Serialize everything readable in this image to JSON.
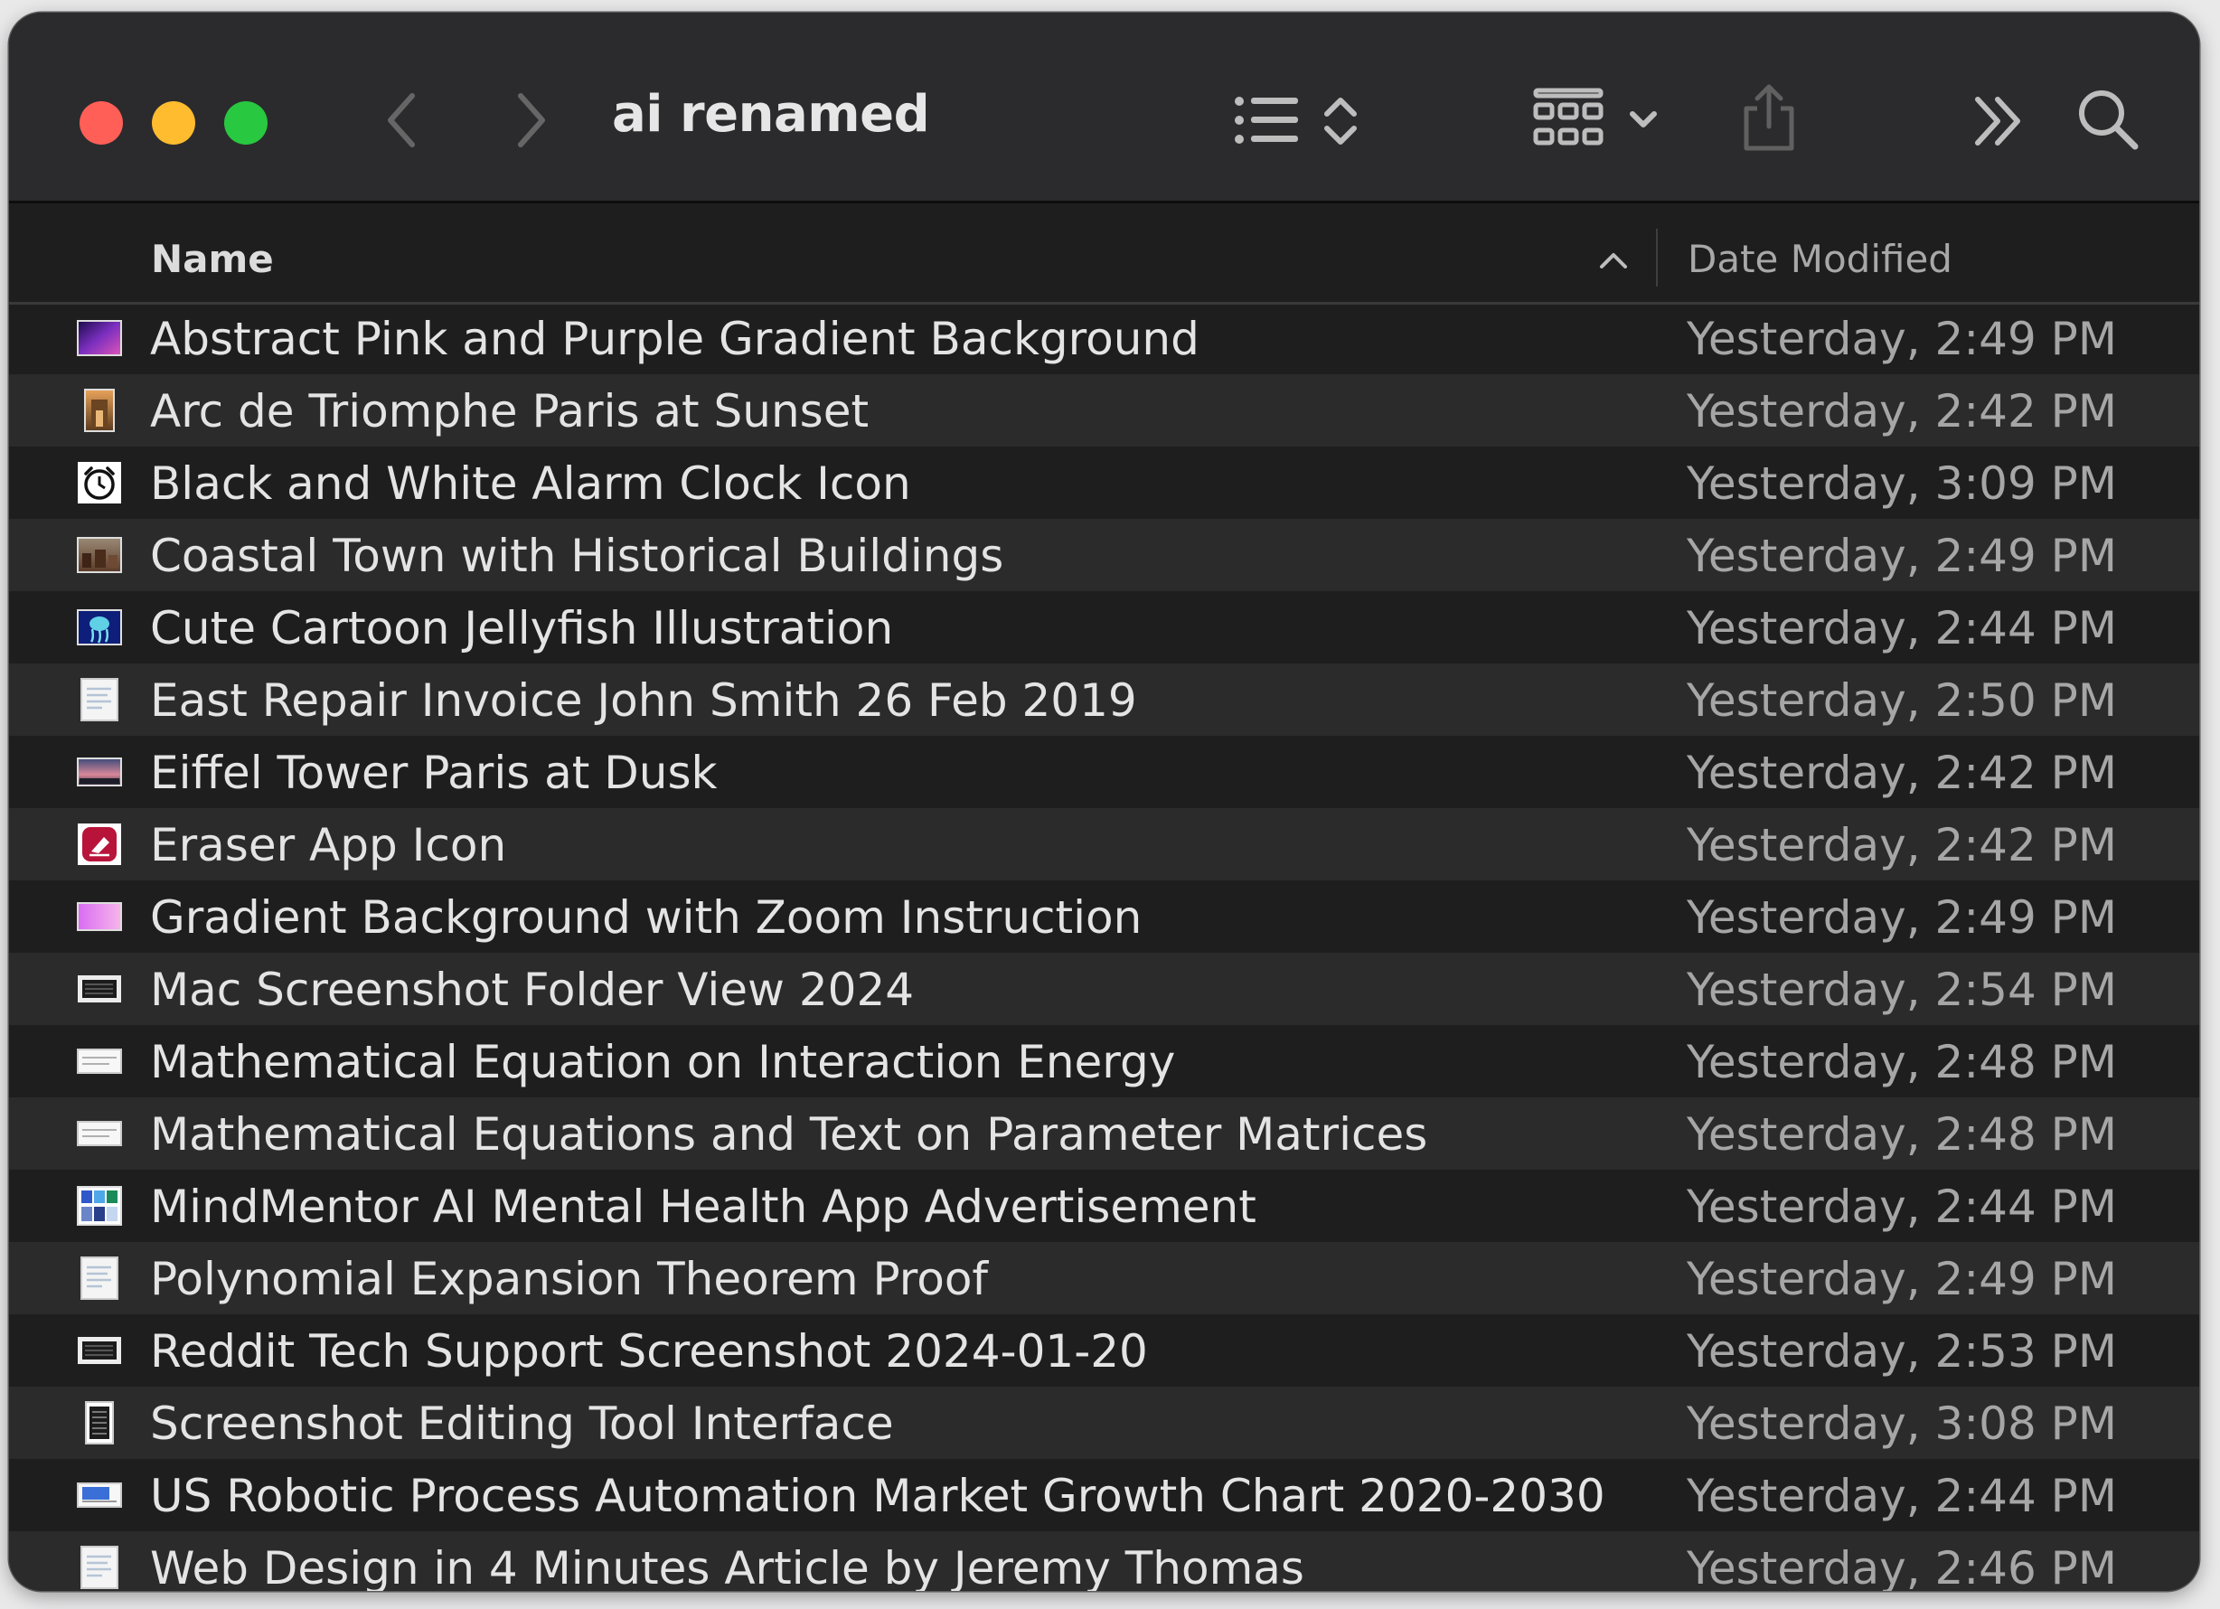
{
  "window": {
    "title": "ai renamed",
    "colors": {
      "close": "#ff5f57",
      "minimize": "#febc2e",
      "zoom": "#28c840"
    }
  },
  "toolbar": {
    "icons": [
      "back-icon",
      "forward-icon",
      "list-view-icon",
      "group-icon",
      "share-icon",
      "more-icon",
      "search-icon"
    ]
  },
  "header": {
    "name_label": "Name",
    "date_label": "Date Modified",
    "sort": "ascending"
  },
  "files": [
    {
      "name": "Abstract Pink and Purple Gradient Background",
      "date": "Yesterday, 2:49 PM",
      "thumb": "gradient-purple"
    },
    {
      "name": "Arc de Triomphe Paris at Sunset",
      "date": "Yesterday, 2:42 PM",
      "thumb": "photo-arc"
    },
    {
      "name": "Black and White Alarm Clock Icon",
      "date": "Yesterday, 3:09 PM",
      "thumb": "clock"
    },
    {
      "name": "Coastal Town with Historical Buildings",
      "date": "Yesterday, 2:49 PM",
      "thumb": "photo-town"
    },
    {
      "name": "Cute Cartoon Jellyfish Illustration",
      "date": "Yesterday, 2:44 PM",
      "thumb": "jellyfish"
    },
    {
      "name": "East Repair Invoice John Smith 26 Feb 2019",
      "date": "Yesterday, 2:50 PM",
      "thumb": "document"
    },
    {
      "name": "Eiffel Tower Paris at Dusk",
      "date": "Yesterday, 2:42 PM",
      "thumb": "photo-dusk"
    },
    {
      "name": "Eraser App Icon",
      "date": "Yesterday, 2:42 PM",
      "thumb": "eraser"
    },
    {
      "name": "Gradient Background with Zoom Instruction",
      "date": "Yesterday, 2:49 PM",
      "thumb": "gradient-pink"
    },
    {
      "name": "Mac Screenshot Folder View 2024",
      "date": "Yesterday, 2:54 PM",
      "thumb": "screenshot-dark"
    },
    {
      "name": "Mathematical Equation on Interaction Energy",
      "date": "Yesterday, 2:48 PM",
      "thumb": "equation"
    },
    {
      "name": "Mathematical Equations and Text on Parameter Matrices",
      "date": "Yesterday, 2:48 PM",
      "thumb": "equation"
    },
    {
      "name": "MindMentor AI Mental Health App Advertisement",
      "date": "Yesterday, 2:44 PM",
      "thumb": "ad-grid"
    },
    {
      "name": "Polynomial Expansion Theorem Proof",
      "date": "Yesterday, 2:49 PM",
      "thumb": "document"
    },
    {
      "name": "Reddit Tech Support Screenshot 2024-01-20",
      "date": "Yesterday, 2:53 PM",
      "thumb": "screenshot-dark"
    },
    {
      "name": "Screenshot Editing Tool Interface",
      "date": "Yesterday, 3:08 PM",
      "thumb": "phone"
    },
    {
      "name": "US Robotic Process Automation Market Growth Chart 2020-2030",
      "date": "Yesterday, 2:44 PM",
      "thumb": "chart"
    },
    {
      "name": "Web Design in 4 Minutes Article by Jeremy Thomas",
      "date": "Yesterday, 2:46 PM",
      "thumb": "document"
    }
  ]
}
